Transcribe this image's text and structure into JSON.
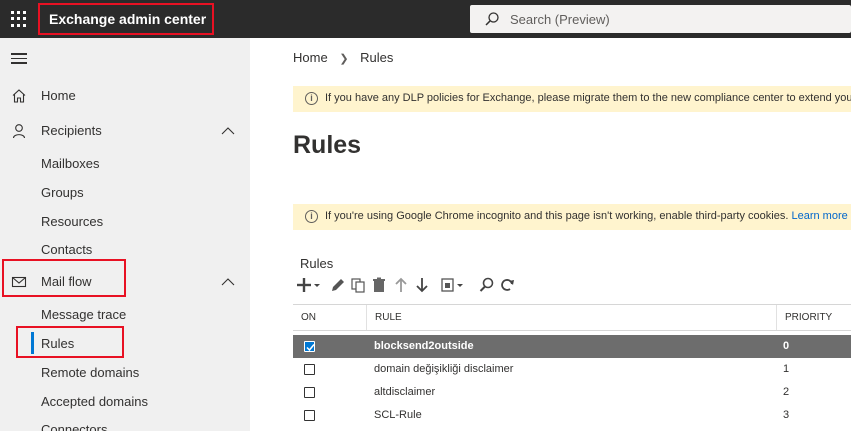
{
  "header": {
    "app_title": "Exchange admin center",
    "search_placeholder": "Search (Preview)"
  },
  "sidebar": {
    "items": [
      {
        "label": "Home",
        "icon": "home-icon"
      },
      {
        "label": "Recipients",
        "icon": "person-icon",
        "expanded": true
      },
      {
        "label": "Mail flow",
        "icon": "mail-icon",
        "expanded": true
      }
    ],
    "recipients_children": [
      "Mailboxes",
      "Groups",
      "Resources",
      "Contacts"
    ],
    "mailflow_children": [
      "Message trace",
      "Rules",
      "Remote domains",
      "Accepted domains",
      "Connectors"
    ],
    "selected": "Rules"
  },
  "main": {
    "breadcrumb": [
      "Home",
      "Rules"
    ],
    "banner1": "If you have any DLP policies for Exchange, please migrate them to the new compliance center to extend your p",
    "banner2_text": "If you're using Google Chrome incognito and this page isn't working, enable third-party cookies.",
    "banner2_link": "Learn more ab",
    "title": "Rules",
    "section_label": "Rules",
    "table": {
      "columns": [
        "ON",
        "RULE",
        "PRIORITY"
      ],
      "rows": [
        {
          "on": true,
          "rule": "blocksend2outside",
          "priority": "0",
          "selected": true
        },
        {
          "on": false,
          "rule": "domain değişikliği disclaimer",
          "priority": "1",
          "selected": false
        },
        {
          "on": false,
          "rule": "altdisclaimer",
          "priority": "2",
          "selected": false
        },
        {
          "on": false,
          "rule": "SCL-Rule",
          "priority": "3",
          "selected": false
        }
      ]
    }
  },
  "colors": {
    "topbar": "#2b2b2b",
    "highlight": "#e81123",
    "banner": "#fff4ce",
    "selected_row": "#6d6d6d",
    "link": "#0066cc"
  }
}
